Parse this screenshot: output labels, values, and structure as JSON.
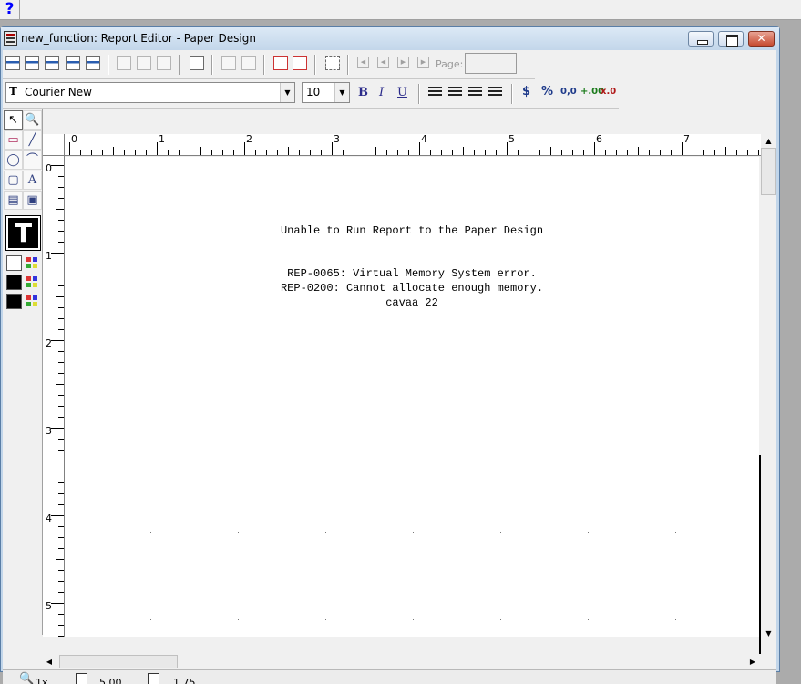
{
  "topbar": {
    "help_glyph": "?"
  },
  "window": {
    "title": "new_function: Report Editor - Paper Design"
  },
  "toolbar": {
    "page_label": "Page:",
    "page_value": ""
  },
  "format": {
    "font_family": "Courier New",
    "font_size": "10",
    "bold": "B",
    "italic": "I",
    "underline": "U",
    "currency": "$",
    "percent": "%",
    "commas": "0,0",
    "add_decimal": "+.00",
    "remove_decimal": "x.0"
  },
  "rulers": {
    "top_numbers": [
      "0",
      "1",
      "2",
      "3",
      "4",
      "5",
      "6",
      "7"
    ],
    "left_numbers": [
      "0",
      "1",
      "2",
      "3",
      "4",
      "5"
    ]
  },
  "canvas": {
    "heading": "Unable to Run Report to the Paper Design",
    "error_1": "REP-0065: Virtual Memory System error.",
    "error_2": "REP-0200: Cannot allocate enough memory.",
    "error_3": "cavaa 22"
  },
  "tools": {
    "text_tool_glyph": "T",
    "text_glyph": "A"
  },
  "status": {
    "zoom": "1x",
    "position_x": "5.00",
    "position_y": "1.75"
  }
}
